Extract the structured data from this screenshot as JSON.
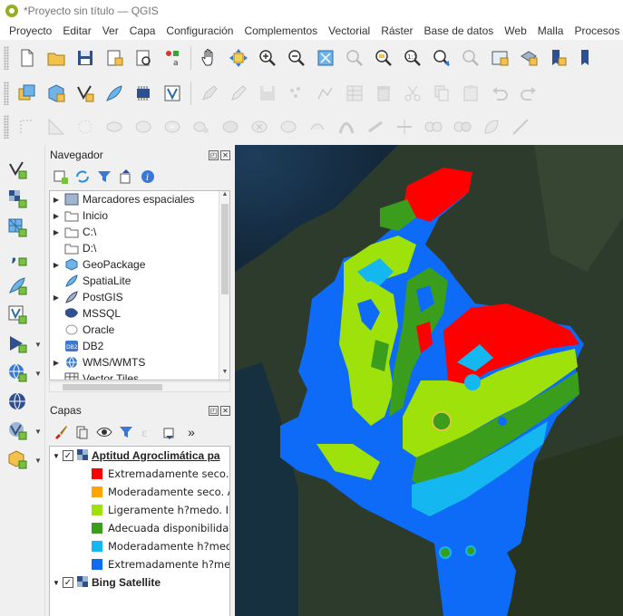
{
  "window": {
    "title": "*Proyecto sin título — QGIS"
  },
  "menu": [
    "Proyecto",
    "Editar",
    "Ver",
    "Capa",
    "Configuración",
    "Complementos",
    "Vectorial",
    "Ráster",
    "Base de datos",
    "Web",
    "Malla",
    "Procesos"
  ],
  "browser_panel": {
    "title": "Navegador",
    "items": [
      {
        "label": "Marcadores espaciales",
        "icon": "bookmarks-icon",
        "expandable": true
      },
      {
        "label": "Inicio",
        "icon": "home-folder-icon",
        "expandable": true
      },
      {
        "label": "C:\\",
        "icon": "drive-icon",
        "expandable": true
      },
      {
        "label": "D:\\",
        "icon": "drive-icon",
        "expandable": false
      },
      {
        "label": "GeoPackage",
        "icon": "geopackage-icon",
        "expandable": true
      },
      {
        "label": "SpatiaLite",
        "icon": "spatialite-icon",
        "expandable": false
      },
      {
        "label": "PostGIS",
        "icon": "postgis-icon",
        "expandable": true
      },
      {
        "label": "MSSQL",
        "icon": "mssql-icon",
        "expandable": false
      },
      {
        "label": "Oracle",
        "icon": "oracle-icon",
        "expandable": false
      },
      {
        "label": "DB2",
        "icon": "db2-icon",
        "expandable": false
      },
      {
        "label": "WMS/WMTS",
        "icon": "wms-icon",
        "expandable": true
      },
      {
        "label": "Vector Tiles",
        "icon": "vector-tiles-icon",
        "expandable": false
      }
    ]
  },
  "layers_panel": {
    "title": "Capas",
    "more_label": "»",
    "layers": [
      {
        "name": "Aptitud Agroclimática pa",
        "checked": true,
        "legend": [
          {
            "label": "Extremadamente seco. L",
            "color": "#ff0000"
          },
          {
            "label": "Moderadamente seco. A",
            "color": "#ffa500"
          },
          {
            "label": "Ligeramente h?medo. In",
            "color": "#9fe10a"
          },
          {
            "label": "Adecuada disponibilidad",
            "color": "#3a9e1c"
          },
          {
            "label": "Moderadamente h?medo",
            "color": "#15b7f0"
          },
          {
            "label": "Extremadamente h?med",
            "color": "#0d6bf7"
          }
        ]
      },
      {
        "name": "Bing Satellite",
        "checked": true
      }
    ]
  },
  "colors": {
    "extremely_dry": "#ff0000",
    "light_humid": "#9fe10a",
    "adequate": "#3a9e1c",
    "moderately_humid": "#15b7f0",
    "extremely_humid": "#0d6bf7",
    "satellite_bg": "#29382a"
  }
}
